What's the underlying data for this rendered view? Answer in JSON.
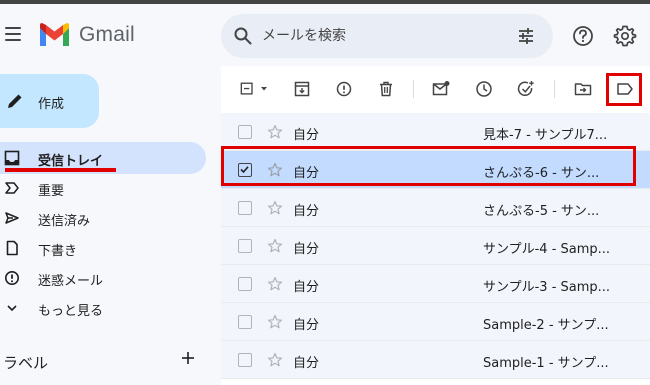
{
  "app": {
    "name": "Gmail"
  },
  "search": {
    "placeholder": "メールを検索"
  },
  "compose": {
    "label": "作成"
  },
  "sidebar": {
    "items": [
      {
        "label": "受信トレイ",
        "icon": "inbox-icon",
        "active": true
      },
      {
        "label": "重要",
        "icon": "important-icon"
      },
      {
        "label": "送信済み",
        "icon": "send-icon"
      },
      {
        "label": "下書き",
        "icon": "draft-icon"
      },
      {
        "label": "迷惑メール",
        "icon": "spam-icon"
      },
      {
        "label": "もっと見る",
        "icon": "chevron-down-icon"
      }
    ],
    "labels_title": "ラベル"
  },
  "toolbar": {
    "buttons": [
      "select-all-checkbox",
      "archive",
      "report-spam",
      "delete",
      "mark-unread",
      "snooze",
      "add-to-tasks",
      "move-to",
      "labels"
    ]
  },
  "emails": [
    {
      "sender": "自分",
      "subject": "見本-7 - サンプル7...",
      "selected": false
    },
    {
      "sender": "自分",
      "subject": "さんぷる-6 - サン...",
      "selected": true
    },
    {
      "sender": "自分",
      "subject": "さんぷる-5 - サン...",
      "selected": false
    },
    {
      "sender": "自分",
      "subject": "サンプル-4 - Samp...",
      "selected": false
    },
    {
      "sender": "自分",
      "subject": "サンプル-3 - Samp...",
      "selected": false
    },
    {
      "sender": "自分",
      "subject": "Sample-2 - サンプ...",
      "selected": false
    },
    {
      "sender": "自分",
      "subject": "Sample-1 - サンプ...",
      "selected": false
    }
  ],
  "colors": {
    "compose_bg": "#c2e7ff",
    "active_nav_bg": "#d3e3fd",
    "selected_row_bg": "#c2dbff",
    "annotation_red": "#e00000"
  }
}
